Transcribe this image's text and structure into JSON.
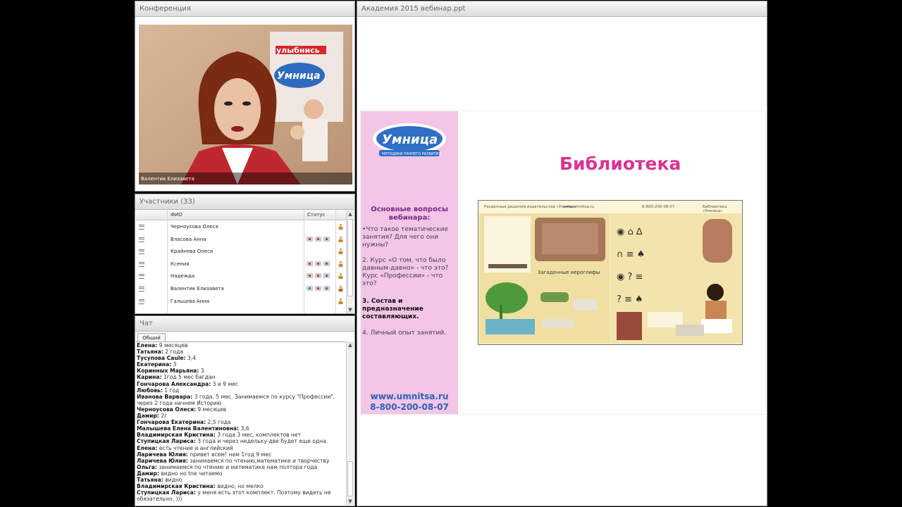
{
  "conference": {
    "title": "Конференция",
    "speaker_name": "Валентик Елизавета",
    "background_sign": "улыбнись",
    "background_logo": "Умница"
  },
  "participants": {
    "title": "Участники (33)",
    "columns": [
      "ФИО",
      "Статус"
    ],
    "rows": [
      {
        "name": "Черноусова Олеся",
        "status_icons": [
          "person-icon"
        ]
      },
      {
        "name": "Власова Анна",
        "status_icons": [
          "camera-icon",
          "microphone-icon",
          "screen-icon",
          "person-icon"
        ]
      },
      {
        "name": "Крайнева Олеся",
        "status_icons": [
          "person-icon"
        ]
      },
      {
        "name": "Ксения",
        "status_icons": [
          "camera-icon",
          "microphone-icon",
          "screen-icon",
          "person-icon"
        ]
      },
      {
        "name": "Надежда",
        "status_icons": [
          "camera-icon",
          "microphone-icon",
          "screen-icon",
          "person-icon"
        ]
      },
      {
        "name": "Валентик Елизавета",
        "status_icons": [
          "headset-icon",
          "microphone-icon",
          "screen-icon",
          "presenter-icon"
        ]
      },
      {
        "name": "Гальцева Анна",
        "status_icons": [
          "person-icon"
        ]
      }
    ]
  },
  "chat": {
    "title": "Чат",
    "tab_label": "Общий",
    "messages": [
      {
        "author": "Елена:",
        "text": " 9 месяцев"
      },
      {
        "author": "Татьяна:",
        "text": " 2 года"
      },
      {
        "author": "Тусупова Саule:",
        "text": " 3,4"
      },
      {
        "author": "Екатерина:",
        "text": " 3"
      },
      {
        "author": "Коринных Марьяна:",
        "text": " 3"
      },
      {
        "author": "Карина:",
        "text": " 1год 5 мес багдан"
      },
      {
        "author": "Гончарова  Александра:",
        "text": " 3 и 9 мес"
      },
      {
        "author": "Любовь:",
        "text": " 1 год"
      },
      {
        "author": "Иванова Варвара:",
        "text": " 3 года. 5 мес. Занимаемся по курсу \"Профессии\", через 2 года начнем Историю"
      },
      {
        "author": "Черноусова Олеся:",
        "text": " 9 месяцев"
      },
      {
        "author": "Дамир:",
        "text": " 2г"
      },
      {
        "author": "Гончарова Екатерина:",
        "text": " 2,5 года"
      },
      {
        "author": "Малышева Елена  Валентиновна:",
        "text": " 3,6"
      },
      {
        "author": "Владимирская Кристина:",
        "text": " 3 года 3 мес, комплектов нет"
      },
      {
        "author": "Ступицкая Лариса:",
        "text": " 3 года и через недельку-две будет еще одна."
      },
      {
        "author": "Елена:",
        "text": " есть чтение и английский"
      },
      {
        "author": "Ларичева Юлия:",
        "text": " привет всем! нам 1год 9 мес"
      },
      {
        "author": "Ларичева Юлия:",
        "text": " занимаемся по чтению,математике и творчеству"
      },
      {
        "author": "Ольга:",
        "text": " занимаемся по чтению и математике нам полтора года"
      },
      {
        "author": "Дамир:",
        "text": " видно но tne читаемо"
      },
      {
        "author": "Татьяна:",
        "text": " видно"
      },
      {
        "author": "Владимирская Кристина:",
        "text": " видно, но мелко"
      },
      {
        "author": "Ступицкая Лариса:",
        "text": " у меня есть этот комплект.  Поэтому видеть не обязательно. )))"
      }
    ]
  },
  "share": {
    "title": "Академия 2015 вебинар.ppt",
    "slide": {
      "logo_text": "Умница",
      "logo_subtext": "МЕТОДИКИ РАННЕГО РАЗВИТИЯ",
      "title": "Библиотека",
      "questions_title": "Основные вопросы вебинара:",
      "q1": "•Что такое тематические занятия? Для чего они нужны?",
      "q2": " 2. Курс «О том, что было давным-давно» - что это? Курс «Профессии» - что это?",
      "q3": "3.  Состав и предназначение составляющих.",
      "q4": "4. Личный опыт занятий.",
      "website": "www.umnitsa.ru",
      "phone": "8-800-200-08-07",
      "book": {
        "header_left": "Разделные решения издательства «Умница»",
        "header_site": "www.umnitsa.ru",
        "header_phone": "8-800-200-08-07",
        "header_right": "Библиотека «Умница»",
        "caption": "Загадочные иероглифы"
      }
    }
  },
  "colors": {
    "slide_pink": "#f3c5e6",
    "title_magenta": "#d93193",
    "contact_blue": "#2c61b8",
    "question_purple": "#7a2a8c"
  }
}
